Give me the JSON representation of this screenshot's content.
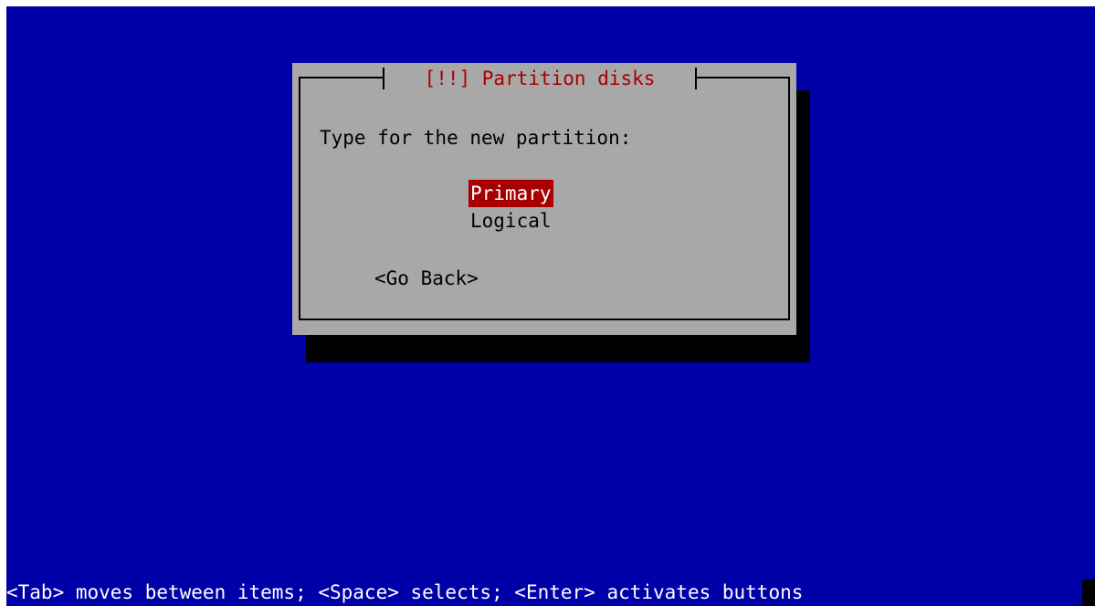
{
  "dialog": {
    "title": "[!!] Partition disks",
    "prompt": "Type for the new partition:",
    "options": [
      {
        "label": "Primary",
        "selected": true
      },
      {
        "label": "Logical",
        "selected": false
      }
    ],
    "go_back_label": "<Go Back>"
  },
  "status_bar": {
    "text": "<Tab> moves between items; <Space> selects; <Enter> activates buttons"
  },
  "colors": {
    "background": "#0000a8",
    "dialog": "#a8a8a8",
    "title": "#a80000",
    "selected_bg": "#a80000",
    "selected_fg": "#ffffff",
    "status_text": "#ffffff"
  }
}
